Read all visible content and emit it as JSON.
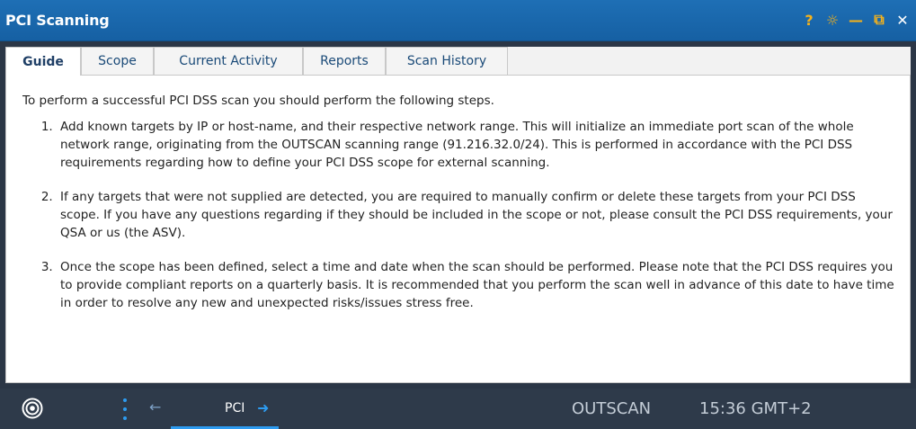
{
  "window": {
    "title": "PCI Scanning",
    "icons": [
      "help-icon",
      "settings-icon",
      "minimize-icon",
      "restore-icon",
      "close-icon"
    ],
    "help_glyph": "?",
    "settings_glyph": "☼",
    "minimize_glyph": "—",
    "restore_glyph": "⧉",
    "close_glyph": "✕"
  },
  "tabs": [
    {
      "label": "Guide",
      "active": true
    },
    {
      "label": "Scope",
      "active": false
    },
    {
      "label": "Current Activity",
      "active": false
    },
    {
      "label": "Reports",
      "active": false
    },
    {
      "label": "Scan History",
      "active": false
    }
  ],
  "guide": {
    "intro": "To perform a successful PCI DSS scan you should perform the following steps.",
    "steps": [
      "Add known targets by IP or host-name, and their respective network range. This will initialize an immediate port scan of the whole network range, originating from the OUTSCAN scanning range (91.216.32.0/24). This is performed in accordance with the PCI DSS requirements regarding how to define your PCI DSS scope for external scanning.",
      "If any targets that were not supplied are detected, you are required to manually confirm or delete these targets from your PCI DSS scope. If you have any questions regarding if they should be included in the scope or not, please consult the PCI DSS requirements, your QSA or us (the ASV).",
      "Once the scope has been defined, select a time and date when the scan should be performed. Please note that the PCI DSS requires you to provide compliant reports on a quarterly basis. It is recommended that you perform the scan well in advance of this date to have time in order to resolve any new and unexpected risks/issues stress free."
    ]
  },
  "taskbar": {
    "back_glyph": "←",
    "window_label": "PCI",
    "forward_glyph": "➜",
    "brand": "OUTSCAN",
    "clock": "15:36 GMT+2"
  },
  "colors": {
    "titlebar": "#1e6fb5",
    "title_icons": "#f6b21a",
    "taskbar": "#2e3a4a",
    "accent": "#2d9bf0"
  }
}
